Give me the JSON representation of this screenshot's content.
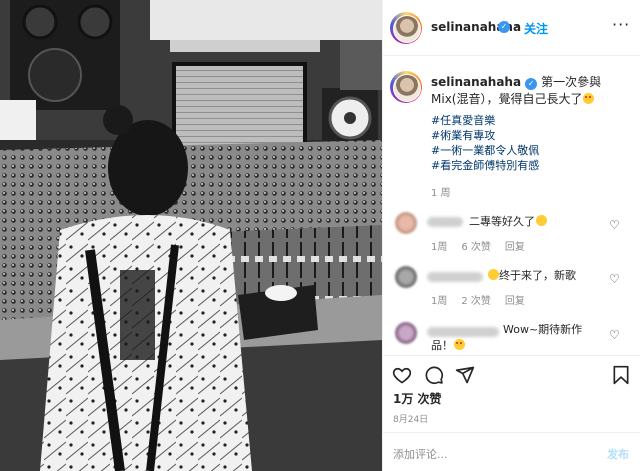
{
  "post": {
    "username": "selinanahaha",
    "follow_label": "关注",
    "more_label": "···",
    "caption": "第一次參與Mix(混音），覺得自己長大了",
    "hashtags": [
      "#任真愛音樂",
      "#術業有專攻",
      "#一術一業都令人敬佩",
      "#看完金師傅特別有感"
    ],
    "caption_time": "1 周"
  },
  "comments": [
    {
      "text": "二專等好久了",
      "time": "1周",
      "likes": "6 次赞",
      "reply": "回复"
    },
    {
      "text": "终于来了，新歌",
      "time": "1周",
      "likes": "2 次赞",
      "reply": "回复"
    },
    {
      "text": "Wow~期待新作品！"
    }
  ],
  "footer": {
    "likes": "1万 次赞",
    "date": "8月24日",
    "add_comment_placeholder": "添加评论...",
    "post_label": "发布"
  },
  "icons": [
    "verified-badge-icon",
    "heart-icon",
    "comment-icon",
    "share-icon",
    "bookmark-icon"
  ],
  "colors": {
    "accent": "#0095f6",
    "hashtag": "#00376b",
    "muted": "#8e8e8e",
    "verified": "#3897f0"
  }
}
